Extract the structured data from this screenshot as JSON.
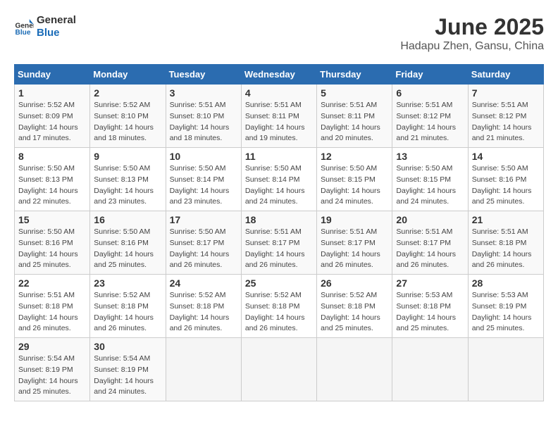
{
  "header": {
    "logo_line1": "General",
    "logo_line2": "Blue",
    "month": "June 2025",
    "location": "Hadapu Zhen, Gansu, China"
  },
  "weekdays": [
    "Sunday",
    "Monday",
    "Tuesday",
    "Wednesday",
    "Thursday",
    "Friday",
    "Saturday"
  ],
  "weeks": [
    [
      {
        "day": "1",
        "sunrise": "5:52 AM",
        "sunset": "8:09 PM",
        "daylight": "14 hours and 17 minutes."
      },
      {
        "day": "2",
        "sunrise": "5:52 AM",
        "sunset": "8:10 PM",
        "daylight": "14 hours and 18 minutes."
      },
      {
        "day": "3",
        "sunrise": "5:51 AM",
        "sunset": "8:10 PM",
        "daylight": "14 hours and 18 minutes."
      },
      {
        "day": "4",
        "sunrise": "5:51 AM",
        "sunset": "8:11 PM",
        "daylight": "14 hours and 19 minutes."
      },
      {
        "day": "5",
        "sunrise": "5:51 AM",
        "sunset": "8:11 PM",
        "daylight": "14 hours and 20 minutes."
      },
      {
        "day": "6",
        "sunrise": "5:51 AM",
        "sunset": "8:12 PM",
        "daylight": "14 hours and 21 minutes."
      },
      {
        "day": "7",
        "sunrise": "5:51 AM",
        "sunset": "8:12 PM",
        "daylight": "14 hours and 21 minutes."
      }
    ],
    [
      {
        "day": "8",
        "sunrise": "5:50 AM",
        "sunset": "8:13 PM",
        "daylight": "14 hours and 22 minutes."
      },
      {
        "day": "9",
        "sunrise": "5:50 AM",
        "sunset": "8:13 PM",
        "daylight": "14 hours and 23 minutes."
      },
      {
        "day": "10",
        "sunrise": "5:50 AM",
        "sunset": "8:14 PM",
        "daylight": "14 hours and 23 minutes."
      },
      {
        "day": "11",
        "sunrise": "5:50 AM",
        "sunset": "8:14 PM",
        "daylight": "14 hours and 24 minutes."
      },
      {
        "day": "12",
        "sunrise": "5:50 AM",
        "sunset": "8:15 PM",
        "daylight": "14 hours and 24 minutes."
      },
      {
        "day": "13",
        "sunrise": "5:50 AM",
        "sunset": "8:15 PM",
        "daylight": "14 hours and 24 minutes."
      },
      {
        "day": "14",
        "sunrise": "5:50 AM",
        "sunset": "8:16 PM",
        "daylight": "14 hours and 25 minutes."
      }
    ],
    [
      {
        "day": "15",
        "sunrise": "5:50 AM",
        "sunset": "8:16 PM",
        "daylight": "14 hours and 25 minutes."
      },
      {
        "day": "16",
        "sunrise": "5:50 AM",
        "sunset": "8:16 PM",
        "daylight": "14 hours and 25 minutes."
      },
      {
        "day": "17",
        "sunrise": "5:50 AM",
        "sunset": "8:17 PM",
        "daylight": "14 hours and 26 minutes."
      },
      {
        "day": "18",
        "sunrise": "5:51 AM",
        "sunset": "8:17 PM",
        "daylight": "14 hours and 26 minutes."
      },
      {
        "day": "19",
        "sunrise": "5:51 AM",
        "sunset": "8:17 PM",
        "daylight": "14 hours and 26 minutes."
      },
      {
        "day": "20",
        "sunrise": "5:51 AM",
        "sunset": "8:17 PM",
        "daylight": "14 hours and 26 minutes."
      },
      {
        "day": "21",
        "sunrise": "5:51 AM",
        "sunset": "8:18 PM",
        "daylight": "14 hours and 26 minutes."
      }
    ],
    [
      {
        "day": "22",
        "sunrise": "5:51 AM",
        "sunset": "8:18 PM",
        "daylight": "14 hours and 26 minutes."
      },
      {
        "day": "23",
        "sunrise": "5:52 AM",
        "sunset": "8:18 PM",
        "daylight": "14 hours and 26 minutes."
      },
      {
        "day": "24",
        "sunrise": "5:52 AM",
        "sunset": "8:18 PM",
        "daylight": "14 hours and 26 minutes."
      },
      {
        "day": "25",
        "sunrise": "5:52 AM",
        "sunset": "8:18 PM",
        "daylight": "14 hours and 26 minutes."
      },
      {
        "day": "26",
        "sunrise": "5:52 AM",
        "sunset": "8:18 PM",
        "daylight": "14 hours and 25 minutes."
      },
      {
        "day": "27",
        "sunrise": "5:53 AM",
        "sunset": "8:18 PM",
        "daylight": "14 hours and 25 minutes."
      },
      {
        "day": "28",
        "sunrise": "5:53 AM",
        "sunset": "8:19 PM",
        "daylight": "14 hours and 25 minutes."
      }
    ],
    [
      {
        "day": "29",
        "sunrise": "5:54 AM",
        "sunset": "8:19 PM",
        "daylight": "14 hours and 25 minutes."
      },
      {
        "day": "30",
        "sunrise": "5:54 AM",
        "sunset": "8:19 PM",
        "daylight": "14 hours and 24 minutes."
      },
      null,
      null,
      null,
      null,
      null
    ]
  ]
}
